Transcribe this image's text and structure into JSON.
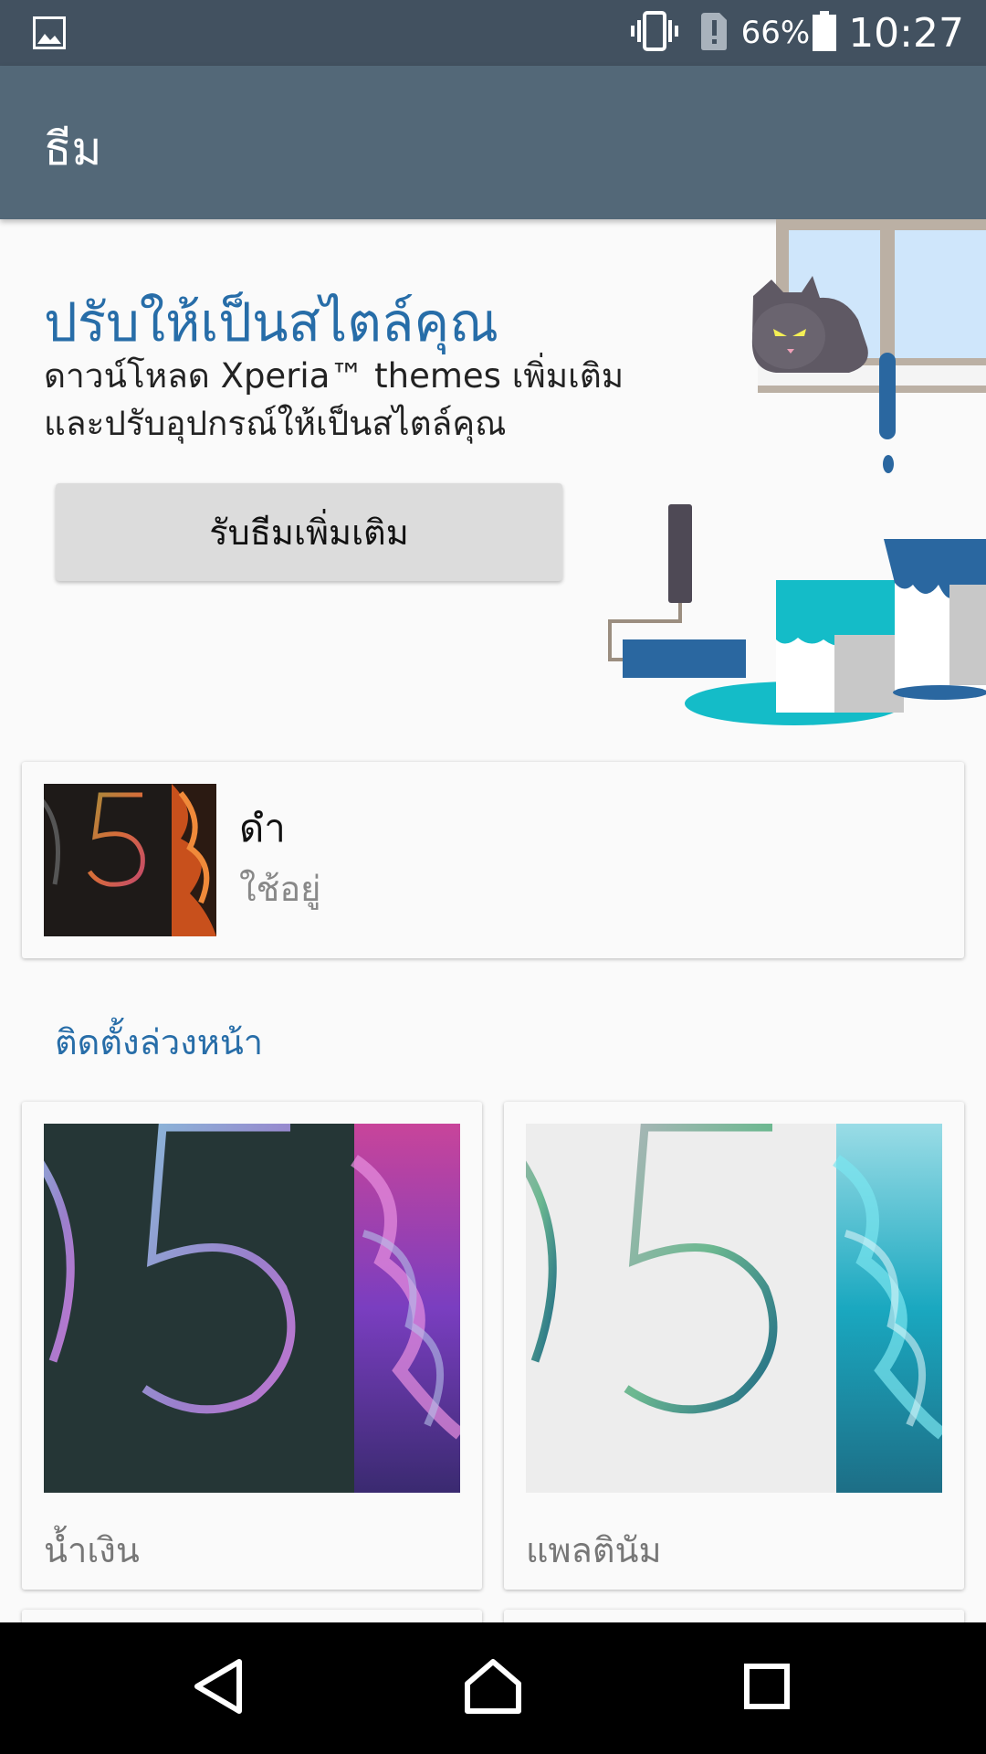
{
  "status_bar": {
    "battery_percent": "66%",
    "time": "10:27",
    "icons": [
      "gallery-icon",
      "vibrate-icon",
      "sim-alert-icon",
      "battery-icon"
    ]
  },
  "app_bar": {
    "title": "ธีม"
  },
  "hero": {
    "title": "ปรับให้เป็นสไตล์คุณ",
    "description_line1": "ดาวน์โหลด Xperia™ themes เพิ่มเติม",
    "description_line2": "และปรับอุปกรณ์ให้เป็นสไตล์คุณ",
    "button_label": "รับธีมเพิ่มเติม"
  },
  "current_theme": {
    "name": "ดำ",
    "status": "ใช้อยู่"
  },
  "preinstalled": {
    "header": "ติดตั้งล่วงหน้า",
    "themes": [
      {
        "label": "น้ำเงิน"
      },
      {
        "label": "แพลตินัม"
      }
    ]
  },
  "nav_bar": {
    "icons": [
      "back-icon",
      "home-icon",
      "recents-icon"
    ]
  },
  "colors": {
    "status_bar": "#425160",
    "app_bar": "#536878",
    "accent": "#276da8"
  }
}
